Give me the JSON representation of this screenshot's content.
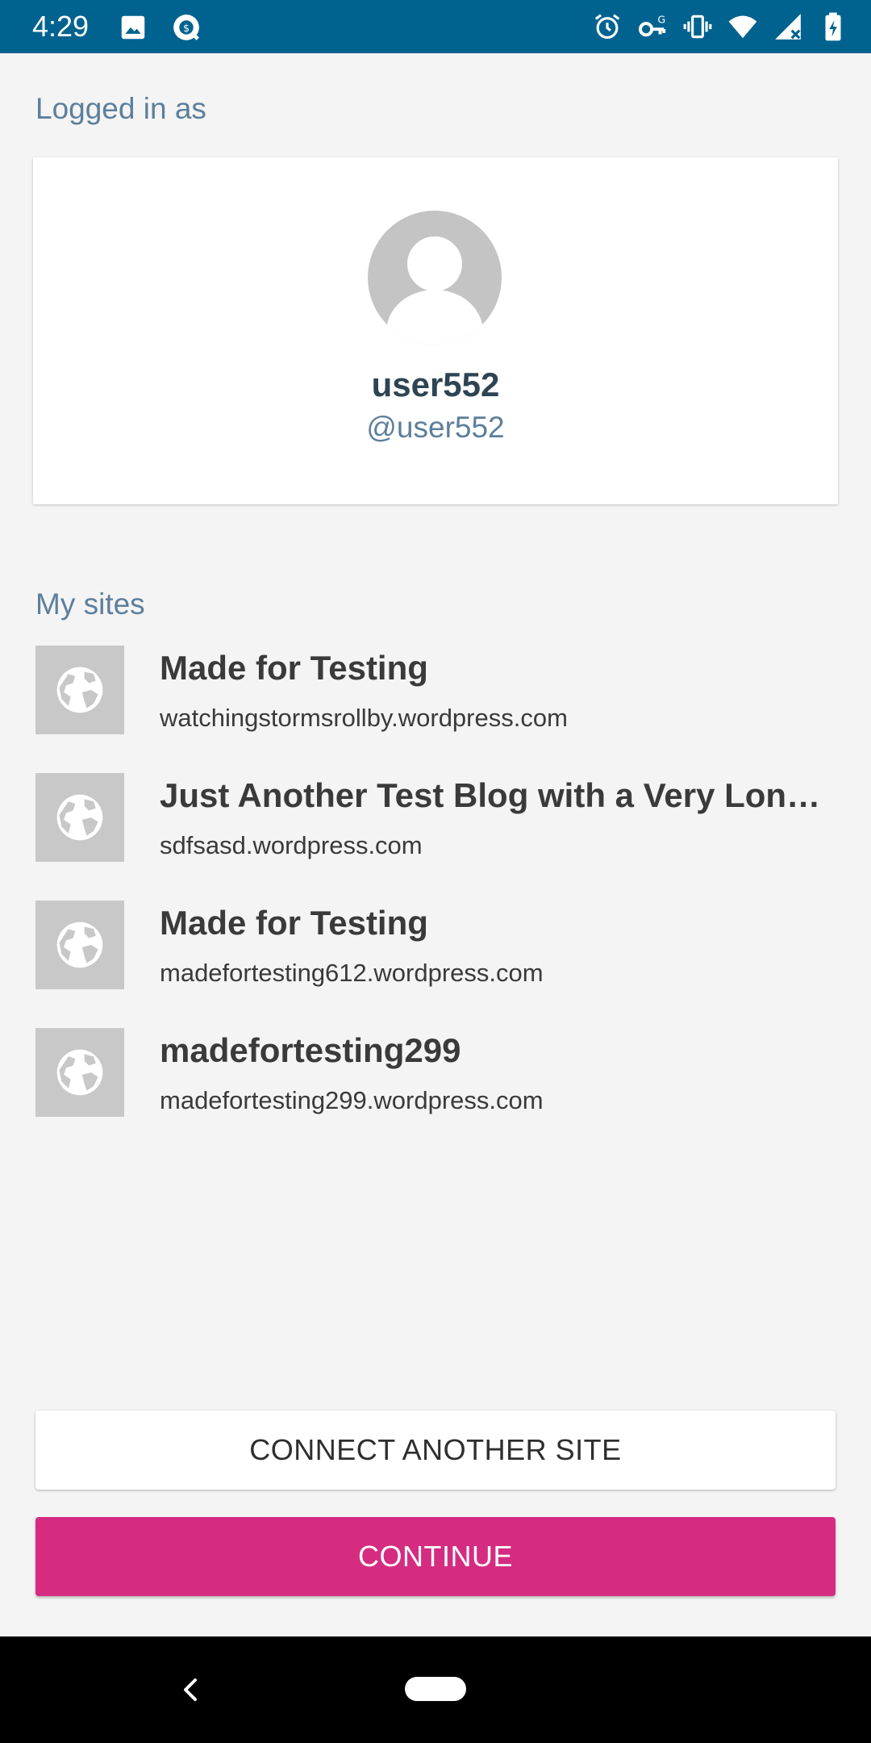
{
  "status_bar": {
    "time": "4:29",
    "left_icons": [
      "image-icon",
      "quickbooks-icon"
    ],
    "right_icons": [
      "alarm-icon",
      "vpn-key-icon",
      "vibrate-icon",
      "wifi-icon",
      "signal-icon",
      "battery-icon"
    ]
  },
  "profile": {
    "section_label": "Logged in as",
    "display_name": "user552",
    "username": "@user552"
  },
  "sites": {
    "section_label": "My sites",
    "items": [
      {
        "title": "Made for Testing",
        "url": "watchingstormsrollby.wordpress.com"
      },
      {
        "title": "Just Another Test Blog with a Very Long…",
        "url": "sdfsasd.wordpress.com"
      },
      {
        "title": "Made for Testing",
        "url": "madefortesting612.wordpress.com"
      },
      {
        "title": "madefortesting299",
        "url": "madefortesting299.wordpress.com"
      }
    ]
  },
  "buttons": {
    "connect_label": "CONNECT ANOTHER SITE",
    "continue_label": "CONTINUE"
  },
  "colors": {
    "status_bar": "#00628f",
    "accent_pink": "#d52c82",
    "label_blue": "#5d7f9c",
    "background": "#f4f4f4"
  }
}
